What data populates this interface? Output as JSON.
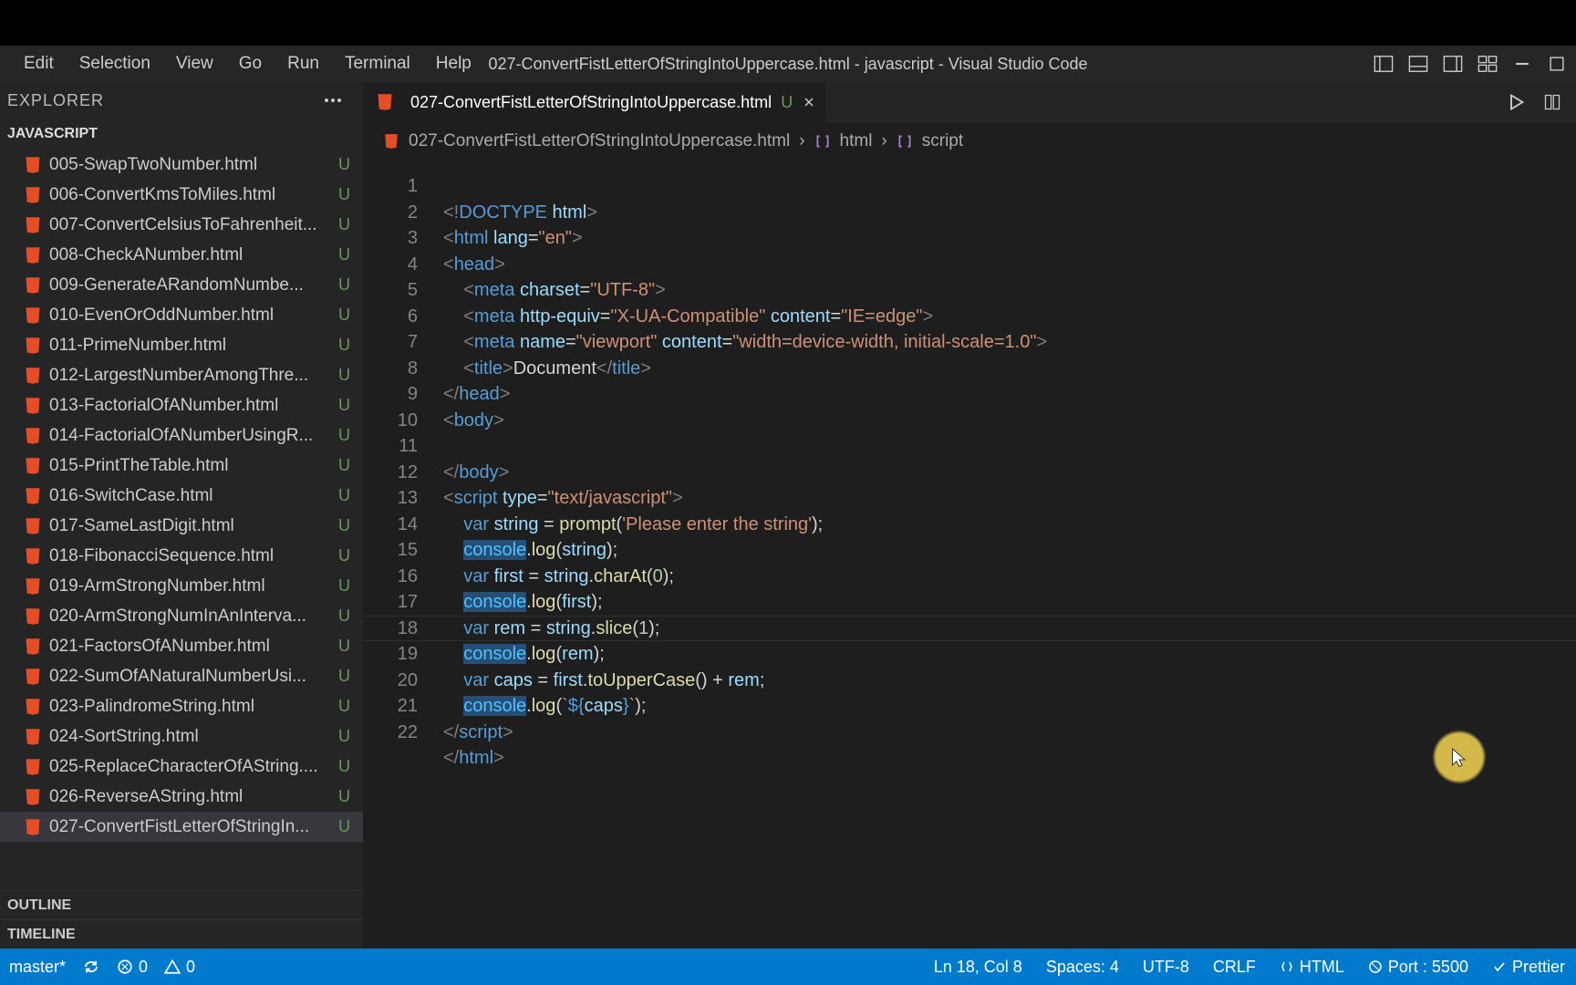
{
  "menu": {
    "edit": "Edit",
    "selection": "Selection",
    "view": "View",
    "go": "Go",
    "run": "Run",
    "terminal": "Terminal",
    "help": "Help"
  },
  "title": "027-ConvertFistLetterOfStringIntoUppercase.html - javascript - Visual Studio Code",
  "explorer": {
    "header": "EXPLORER",
    "section": "JAVASCRIPT",
    "outline": "OUTLINE",
    "timeline": "TIMELINE"
  },
  "files": [
    {
      "name": "005-SwapTwoNumber.html",
      "status": "U"
    },
    {
      "name": "006-ConvertKmsToMiles.html",
      "status": "U"
    },
    {
      "name": "007-ConvertCelsiusToFahrenheit...",
      "status": "U"
    },
    {
      "name": "008-CheckANumber.html",
      "status": "U"
    },
    {
      "name": "009-GenerateARandomNumbe...",
      "status": "U"
    },
    {
      "name": "010-EvenOrOddNumber.html",
      "status": "U"
    },
    {
      "name": "011-PrimeNumber.html",
      "status": "U"
    },
    {
      "name": "012-LargestNumberAmongThre...",
      "status": "U"
    },
    {
      "name": "013-FactorialOfANumber.html",
      "status": "U"
    },
    {
      "name": "014-FactorialOfANumberUsingR...",
      "status": "U"
    },
    {
      "name": "015-PrintTheTable.html",
      "status": "U"
    },
    {
      "name": "016-SwitchCase.html",
      "status": "U"
    },
    {
      "name": "017-SameLastDigit.html",
      "status": "U"
    },
    {
      "name": "018-FibonacciSequence.html",
      "status": "U"
    },
    {
      "name": "019-ArmStrongNumber.html",
      "status": "U"
    },
    {
      "name": "020-ArmStrongNumInAnInterva...",
      "status": "U"
    },
    {
      "name": "021-FactorsOfANumber.html",
      "status": "U"
    },
    {
      "name": "022-SumOfANaturalNumberUsi...",
      "status": "U"
    },
    {
      "name": "023-PalindromeString.html",
      "status": "U"
    },
    {
      "name": "024-SortString.html",
      "status": "U"
    },
    {
      "name": "025-ReplaceCharacterOfAString....",
      "status": "U"
    },
    {
      "name": "026-ReverseAString.html",
      "status": "U"
    },
    {
      "name": "027-ConvertFistLetterOfStringIn...",
      "status": "U"
    }
  ],
  "tab": {
    "name": "027-ConvertFistLetterOfStringIntoUppercase.html",
    "mod": "U"
  },
  "breadcrumb": {
    "file": "027-ConvertFistLetterOfStringIntoUppercase.html",
    "p1": "html",
    "p2": "script"
  },
  "lines": 22,
  "status": {
    "branch": "master*",
    "errors": "0",
    "warnings": "0",
    "lncol": "Ln 18, Col 8",
    "spaces": "Spaces: 4",
    "encoding": "UTF-8",
    "eol": "CRLF",
    "lang": "HTML",
    "port": "Port : 5500",
    "prettier": "Prettier"
  }
}
